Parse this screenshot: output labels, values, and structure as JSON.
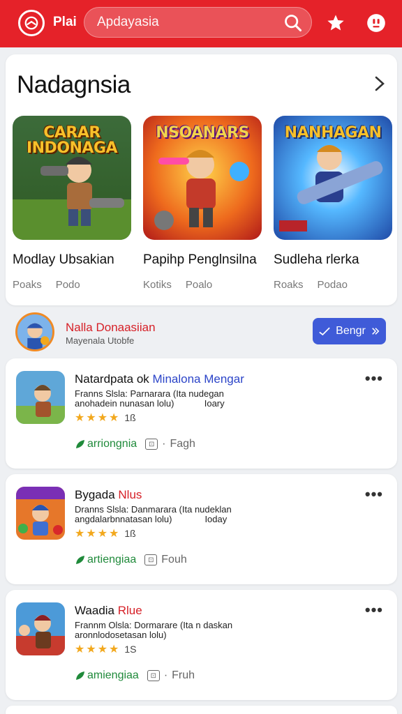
{
  "header": {
    "brand": "Plai",
    "search_placeholder": "Apdayasia",
    "icons": [
      "logo-icon",
      "search-icon",
      "star-icon",
      "account-icon"
    ]
  },
  "featured": {
    "heading": "Nadagnsia",
    "games": [
      {
        "art_title": "CARAR INDONAGA",
        "name": "Modlay Ubsakian",
        "meta1": "Poaks",
        "meta2": "Podo"
      },
      {
        "art_title": "NSOANARS",
        "name": "Papihp Penglnsilna",
        "meta1": "Kotiks",
        "meta2": "Poalo"
      },
      {
        "art_title": "NANHAGAN",
        "name": "Sudleha rlerka",
        "meta1": "Roaks",
        "meta2": "Podao"
      }
    ]
  },
  "publisher": {
    "name": "Nalla Donaasiian",
    "sub": "Mayenala Utobfe",
    "button": "Bengr"
  },
  "items": [
    {
      "title_main": "Natardpata ok ",
      "title_accent": "Minalona Mengar",
      "desc1": "Franns Slsla: Parnarara (Ita nudegan",
      "desc2": "anohadein nunasan lolu)            Ioary",
      "rating_count": "1ß",
      "category": "arriongnia",
      "version": "Fagh"
    },
    {
      "title_main": "Bygada ",
      "title_accent": "Nlus",
      "desc1": "Dranns Slsla: Danmarara (Ita nudeklan",
      "desc2": "angdalarbnnatasan lolu)             Ioday",
      "rating_count": "1ß",
      "category": "artiengiaa",
      "version": "Fouh"
    },
    {
      "title_main": "Waadia ",
      "title_accent": "Rlue",
      "desc1": "Frannm Olsla: Dormarare (Ita n daskan",
      "desc2": "aronnlodosetasan lolu)",
      "rating_count": "1S",
      "category": "amiengiaa",
      "version": "Fruh"
    }
  ],
  "colors": {
    "header_red": "#e52229",
    "button_blue": "#3f5bd8",
    "star_gold": "#f2a81d",
    "category_green": "#1f8a3a"
  }
}
